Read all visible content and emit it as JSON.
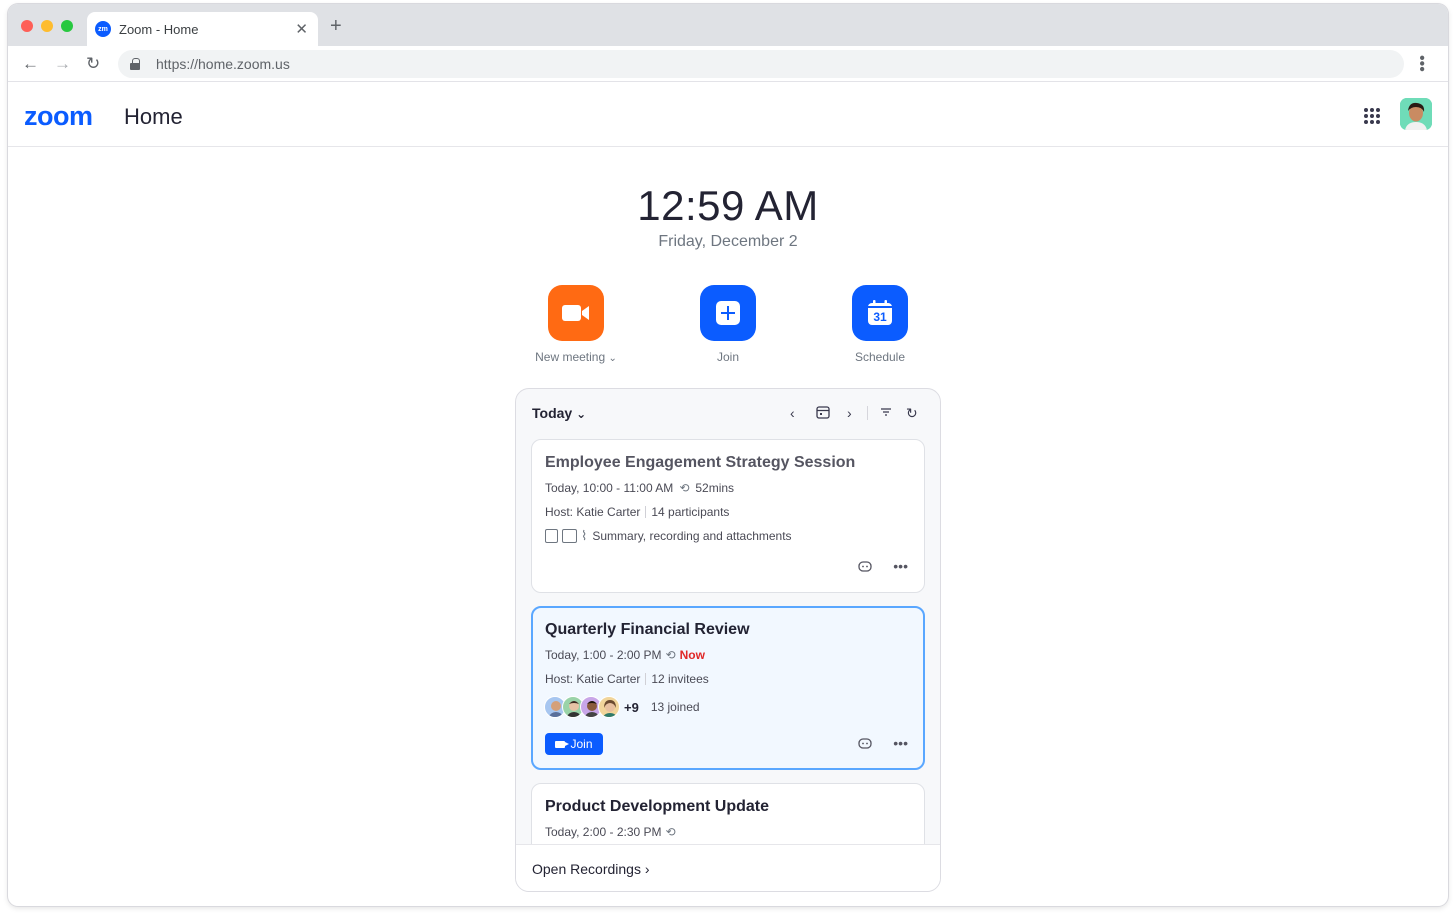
{
  "browser": {
    "tab_title": "Zoom - Home",
    "tab_favicon": "zm",
    "url": "https://home.zoom.us"
  },
  "header": {
    "logo": "zoom",
    "title": "Home"
  },
  "clock": {
    "time": "12:59 AM",
    "date": "Friday, December 2"
  },
  "actions": {
    "new_meeting": "New meeting",
    "join": "Join",
    "schedule": "Schedule",
    "schedule_day": "31"
  },
  "meetings_panel": {
    "day_selector": "Today",
    "meetings": [
      {
        "title": "Employee Engagement Strategy Session",
        "time": "Today, 10:00 - 11:00 AM",
        "duration": "52mins",
        "host": "Host: Katie Carter",
        "attendance": "14 participants",
        "attachments": "Summary, recording and attachments"
      },
      {
        "title": "Quarterly Financial Review",
        "time": "Today, 1:00 - 2:00 PM",
        "status": "Now",
        "host": "Host: Katie Carter",
        "attendance": "12 invitees",
        "more_count": "+9",
        "joined": "13 joined",
        "join_label": "Join"
      },
      {
        "title": "Product Development Update",
        "time": "Today, 2:00 - 2:30 PM"
      }
    ],
    "footer_link": "Open Recordings"
  },
  "colors": {
    "brand": "#0b5cff",
    "new_meeting": "#ff6a13",
    "now": "#e02828"
  }
}
